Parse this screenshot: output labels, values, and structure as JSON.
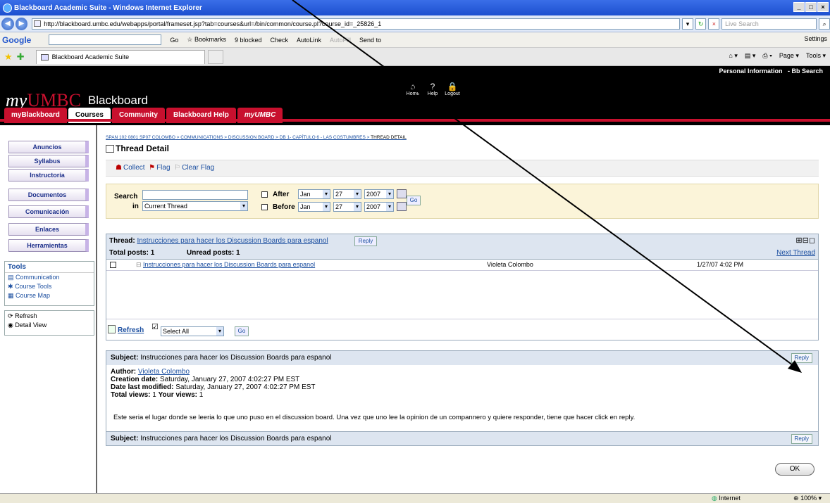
{
  "window": {
    "title": "Blackboard Academic Suite - Windows Internet Explorer"
  },
  "browser": {
    "address": "http://blackboard.umbc.edu/webapps/portal/frameset.jsp?tab=courses&url=/bin/common/course.pl?course_id=_25826_1",
    "live_search_placeholder": "Live Search",
    "tab_title": "Blackboard Academic Suite",
    "toolbar": {
      "google_label": "Google",
      "go": "Go",
      "bookmarks": "Bookmarks",
      "blocked": "9 blocked",
      "check": "Check",
      "autolink": "AutoLink",
      "autofill": "AutoFill",
      "send_to": "Send to",
      "settings": "Settings"
    },
    "commands": {
      "page": "Page",
      "tools": "Tools"
    }
  },
  "header": {
    "logo_my": "my",
    "logo_umbc": "UMBC",
    "logo_blackboard": "Blackboard",
    "personal_information": "Personal Information",
    "bb_search": "Bb Search",
    "icons": [
      {
        "label": "Home",
        "glyph": "⌂"
      },
      {
        "label": "Help",
        "glyph": "?"
      },
      {
        "label": "Logout",
        "glyph": "🔒"
      }
    ],
    "tabs": [
      "myBlackboard",
      "Courses",
      "Community",
      "Blackboard Help",
      "myUMBC"
    ]
  },
  "sidebar": {
    "items": [
      "Anuncios",
      "Syllabus",
      "Instructoría",
      "Documentos",
      "Comunicación",
      "Enlaces",
      "Herramientas"
    ],
    "tools_title": "Tools",
    "tools": [
      "Communication",
      "Course Tools",
      "Course Map"
    ],
    "refresh": "Refresh",
    "detail_view": "Detail View"
  },
  "main": {
    "breadcrumb": [
      "SPAN 102 0801 SP07 COLOMBO",
      "COMMUNICATIONS",
      "DISCUSSION BOARD",
      "DB 1- CAPÍTULO 6 - LAS COSTUMBRES",
      "THREAD DETAIL"
    ],
    "title": "Thread Detail",
    "actions": {
      "collect": "Collect",
      "flag": "Flag",
      "clear_flag": "Clear Flag"
    },
    "search": {
      "label": "Search",
      "in_label": "in",
      "scope": "Current Thread",
      "after": "After",
      "before": "Before",
      "month": "Jan",
      "day": "27",
      "year": "2007",
      "go": "Go"
    },
    "thread": {
      "label": "Thread:",
      "name": "Instrucciones para hacer los Discussion Boards para espanol",
      "reply": "Reply",
      "total_posts_label": "Total posts:",
      "total_posts": "1",
      "unread_posts_label": "Unread posts:",
      "unread_posts": "1",
      "next_thread": "Next Thread",
      "rows": [
        {
          "subject": "Instrucciones para hacer los Discussion Boards para espanol",
          "author": "Violeta Colombo",
          "date": "1/27/07 4:02 PM"
        }
      ],
      "refresh": "Refresh",
      "select_all": "Select All",
      "go": "Go"
    },
    "message": {
      "subject_label": "Subject:",
      "subject": "Instrucciones para hacer los Discussion Boards para espanol",
      "reply": "Reply",
      "author_label": "Author:",
      "author": "Violeta Colombo",
      "creation_label": "Creation date:",
      "creation": "Saturday, January 27, 2007 4:02:27 PM EST",
      "modified_label": "Date last modified:",
      "modified": "Saturday, January 27, 2007 4:02:27 PM EST",
      "views_label": "Total views:",
      "views": "1",
      "your_views_label": "Your views:",
      "your_views": "1",
      "body": "Este seria el lugar donde se leeria lo que uno puso en el discussion board. Una vez que uno lee la opinion de un compannero y quiere responder, tiene que hacer click en reply."
    },
    "ok": "OK"
  },
  "status": {
    "zone": "Internet",
    "zoom": "100%"
  }
}
